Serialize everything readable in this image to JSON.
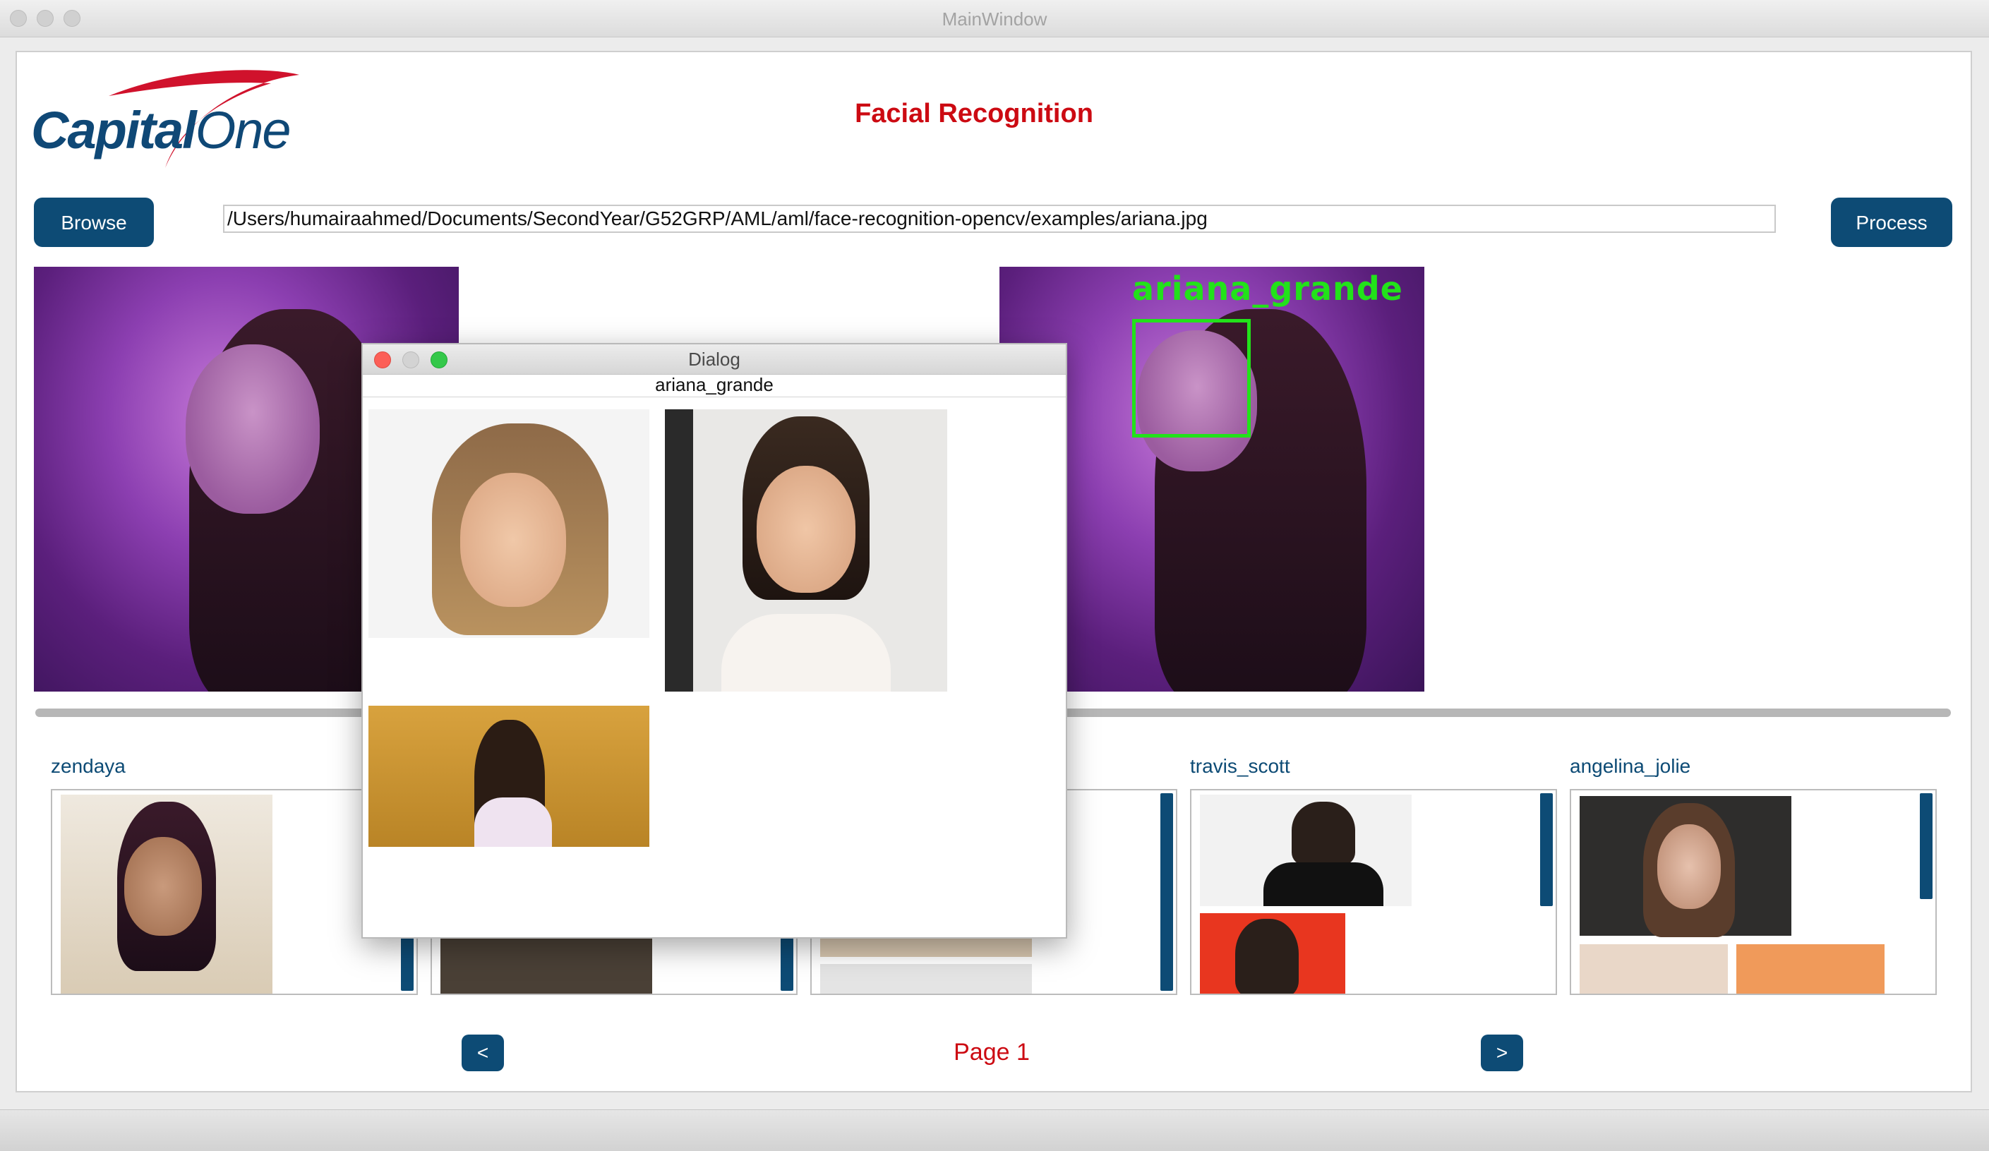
{
  "window": {
    "title": "MainWindow"
  },
  "header": {
    "logo_text_capital": "Capital",
    "logo_text_one": "One",
    "title": "Facial Recognition"
  },
  "toolbar": {
    "browse_label": "Browse",
    "path_value": "/Users/humairaahmed/Documents/SecondYear/G52GRP/AML/aml/face-recognition-opencv/examples/ariana.jpg",
    "process_label": "Process"
  },
  "result": {
    "detected_label": "ariana_grande"
  },
  "gallery": {
    "categories": [
      {
        "label": "zendaya"
      },
      {
        "label": ""
      },
      {
        "label": ""
      },
      {
        "label": "travis_scott"
      },
      {
        "label": "angelina_jolie"
      }
    ],
    "prev_label": "<",
    "next_label": ">",
    "page_label": "Page 1"
  },
  "dialog": {
    "title": "Dialog",
    "name": "ariana_grande"
  },
  "colors": {
    "accent_blue": "#0d4b75",
    "brand_red": "#cc0a12",
    "detect_green": "#22e21a"
  }
}
